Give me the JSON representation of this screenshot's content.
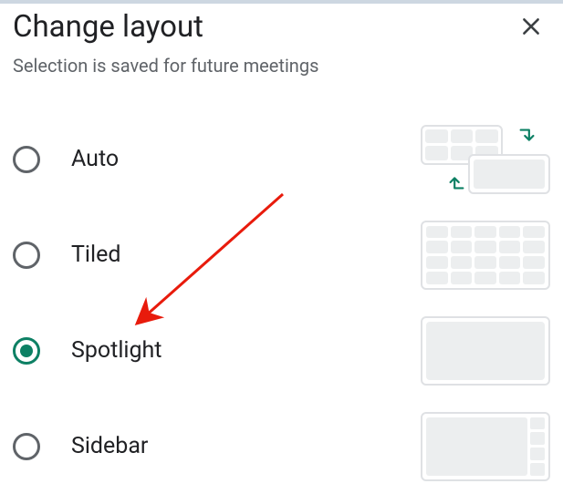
{
  "dialog": {
    "title": "Change layout",
    "subtitle": "Selection is saved for future meetings"
  },
  "options": [
    {
      "id": "auto",
      "label": "Auto",
      "selected": false
    },
    {
      "id": "tiled",
      "label": "Tiled",
      "selected": false
    },
    {
      "id": "spotlight",
      "label": "Spotlight",
      "selected": true
    },
    {
      "id": "sidebar",
      "label": "Sidebar",
      "selected": false
    }
  ],
  "annotation": {
    "type": "arrow",
    "color": "#e81b0c",
    "target": "spotlight"
  }
}
